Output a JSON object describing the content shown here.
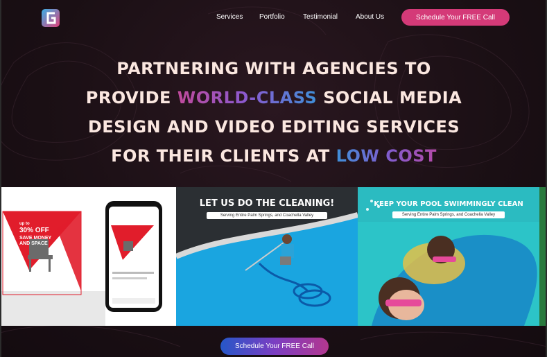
{
  "nav": {
    "items": [
      {
        "label": "Services"
      },
      {
        "label": "Portfolio"
      },
      {
        "label": "Testimonial"
      },
      {
        "label": "About Us"
      }
    ],
    "cta_label": "Schedule Your FREE Call"
  },
  "hero": {
    "line1": "PARTNERING WITH AGENCIES TO",
    "line2_pre": "PROVIDE ",
    "line2_accent": "WORLD-CLASS",
    "line2_post": " SOCIAL MEDIA",
    "line3": "DESIGN AND VIDEO EDITING SERVICES",
    "line4_pre": "FOR THEIR CLIENTS AT ",
    "line4_accent": "LOW COST"
  },
  "portfolio": {
    "card1": {
      "offer_pre": "up to",
      "offer_big": "30% OFF",
      "offer_text": "SAVE MONEY AND SPACE"
    },
    "card2": {
      "title": "LET US DO THE CLEANING!",
      "subtitle": "Serving Entire Palm Springs, and Coachella Valley"
    },
    "card3": {
      "title": "KEEP YOUR POOL SWIMMINGLY CLEAN",
      "subtitle": "Serving Entire Palm Springs, and Coachella Valley"
    }
  },
  "bottom_cta_label": "Schedule Your FREE Call",
  "colors": {
    "background": "#1a0f14",
    "cta_top": "#d43a78",
    "accent_gradient": [
      "#c04a9c",
      "#3f8fd8"
    ]
  }
}
